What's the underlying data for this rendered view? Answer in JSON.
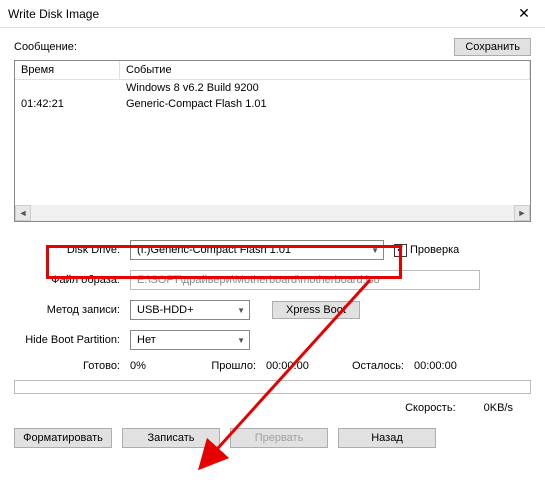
{
  "window": {
    "title": "Write Disk Image"
  },
  "message_section": {
    "label": "Сообщение:",
    "save_btn": "Сохранить"
  },
  "log": {
    "col_time": "Время",
    "col_event": "Событие",
    "rows": [
      {
        "time": "",
        "event": "Windows 8 v6.2 Build 9200"
      },
      {
        "time": "01:42:21",
        "event": "Generic-Compact Flash   1.01"
      }
    ]
  },
  "form": {
    "disk_drive_label": "Disk Drive:",
    "disk_drive_value": "(I:)Generic-Compact Flash   1.01",
    "verify_label": "Проверка",
    "image_label": "Файл образа:",
    "image_value": "E:\\SOFT\\драйвери\\Motherboard\\motherboard.iso",
    "method_label": "Метод записи:",
    "method_value": "USB-HDD+",
    "xpress_btn": "Xpress Boot",
    "hide_label": "Hide Boot Partition:",
    "hide_value": "Нет"
  },
  "status": {
    "ready_label": "Готово:",
    "ready_value": "0%",
    "elapsed_label": "Прошло:",
    "elapsed_value": "00:00:00",
    "remain_label": "Осталось:",
    "remain_value": "00:00:00",
    "speed_label": "Скорость:",
    "speed_value": "0KB/s"
  },
  "buttons": {
    "format": "Форматировать",
    "write": "Записать",
    "abort": "Прервать",
    "back": "Назад"
  }
}
